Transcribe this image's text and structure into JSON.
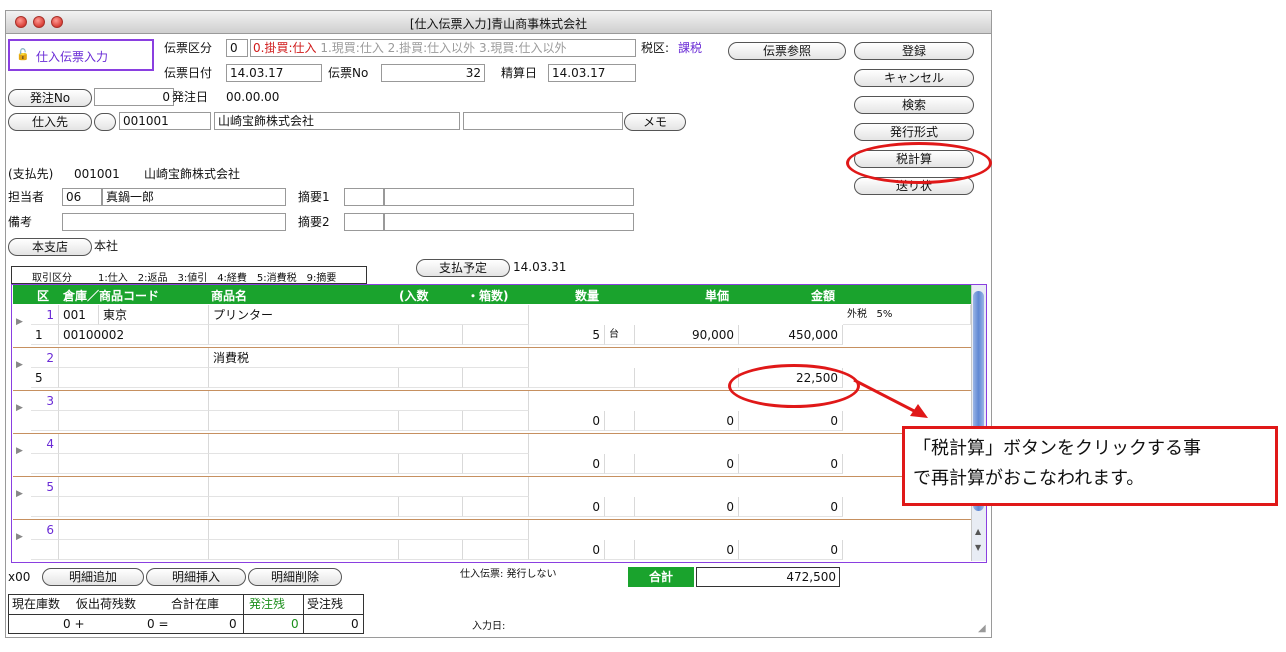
{
  "window": {
    "title": "[仕入伝票入力]青山商事株式会社"
  },
  "mode_label": "仕入伝票入力",
  "header": {
    "denpyo_kubun_label": "伝票区分",
    "denpyo_kubun_value": "0",
    "kubun_options": {
      "opt0": "0.掛買:仕入",
      "opt1": "1.現買:仕入",
      "opt2": "2.掛買:仕入以外",
      "opt3": "3.現買:仕入以外"
    },
    "zeiku_label": "税区:",
    "zeiku_value": "課税",
    "denpyo_date_label": "伝票日付",
    "denpyo_date_value": "14.03.17",
    "denpyo_no_label": "伝票No",
    "denpyo_no_value": "32",
    "seisan_label": "精算日",
    "seisan_value": "14.03.17",
    "hatchu_no_value": "0",
    "hatchu_date_label": "発注日",
    "hatchu_date_value": "00.00.00",
    "shiire_code": "001001",
    "shiire_name": "山崎宝飾株式会社"
  },
  "buttons": {
    "denpyo_sansho": "伝票参照",
    "toroku": "登録",
    "cancel": "キャンセル",
    "kensaku": "検索",
    "hakko": "発行形式",
    "zei_keisan": "税計算",
    "okurijo": "送り状",
    "hatchu_no": "発注No",
    "shiiresaki": "仕入先",
    "memo": "メモ",
    "honshiten": "本支店",
    "shiharai": "支払予定",
    "add_row": "明細追加",
    "insert_row": "明細挿入",
    "delete_row": "明細削除"
  },
  "info": {
    "shiharai_label": "(支払先)",
    "shiharai_code": "001001",
    "shiharai_name": "山崎宝飾株式会社",
    "tanto_label": "担当者",
    "tanto_code": "06",
    "tanto_name": "真鍋一郎",
    "biko_label": "備考",
    "tekiyo1_label": "摘要1",
    "tekiyo2_label": "摘要2",
    "honshiten_value": "本社",
    "shiharai_date": "14.03.31",
    "torihiki_label": "取引区分",
    "torihiki_codes": "1:仕入　2:返品　3:値引　4:経費　5:消費税　9:摘要"
  },
  "grid": {
    "headers": {
      "ku": "区",
      "code": "倉庫／商品コード",
      "name": "商品名",
      "irisu": "(入数",
      "hakosu": "・箱数)",
      "suryo": "数量",
      "tanka": "単価",
      "kingaku": "金額"
    },
    "rows": [
      {
        "no": "1",
        "soko": "001",
        "soko_name": "東京",
        "name": "プリンター",
        "kubun": "1",
        "code": "00100002",
        "qty": "5",
        "unit": "台",
        "price": "90,000",
        "amount": "450,000",
        "tax_label": "外税",
        "tax_rate": "5%"
      },
      {
        "no": "2",
        "name": "消費税",
        "kubun": "5",
        "amount": "22,500"
      },
      {
        "no": "3",
        "qty": "0",
        "price": "0",
        "amount": "0"
      },
      {
        "no": "4",
        "qty": "0",
        "price": "0",
        "amount": "0"
      },
      {
        "no": "5",
        "qty": "0",
        "price": "0",
        "amount": "0"
      },
      {
        "no": "6",
        "qty": "0",
        "price": "0",
        "amount": "0"
      }
    ]
  },
  "footer": {
    "x00": "x00",
    "print_status": "仕入伝票: 発行しない",
    "total_label": "合計",
    "total_value": "472,500",
    "stock_headers": {
      "genzai": "現在庫数",
      "karishukka": "仮出荷残数",
      "gokei": "合計在庫",
      "hatchuzan": "発注残",
      "juchuzan": "受注残"
    },
    "stock_values": {
      "genzai": "0 +",
      "karishukka": "0 =",
      "gokei": "0",
      "hatchuzan": "0",
      "juchuzan": "0"
    },
    "nyuryoku_label": "入力日:"
  },
  "annotation": {
    "line1": "「税計算」ボタンをクリックする事",
    "line2": "で再計算がおこなわれます。"
  },
  "colors": {
    "green_header": "#1aa32d",
    "red_annotation": "#e01818",
    "mode_border": "#8a3fe0"
  }
}
